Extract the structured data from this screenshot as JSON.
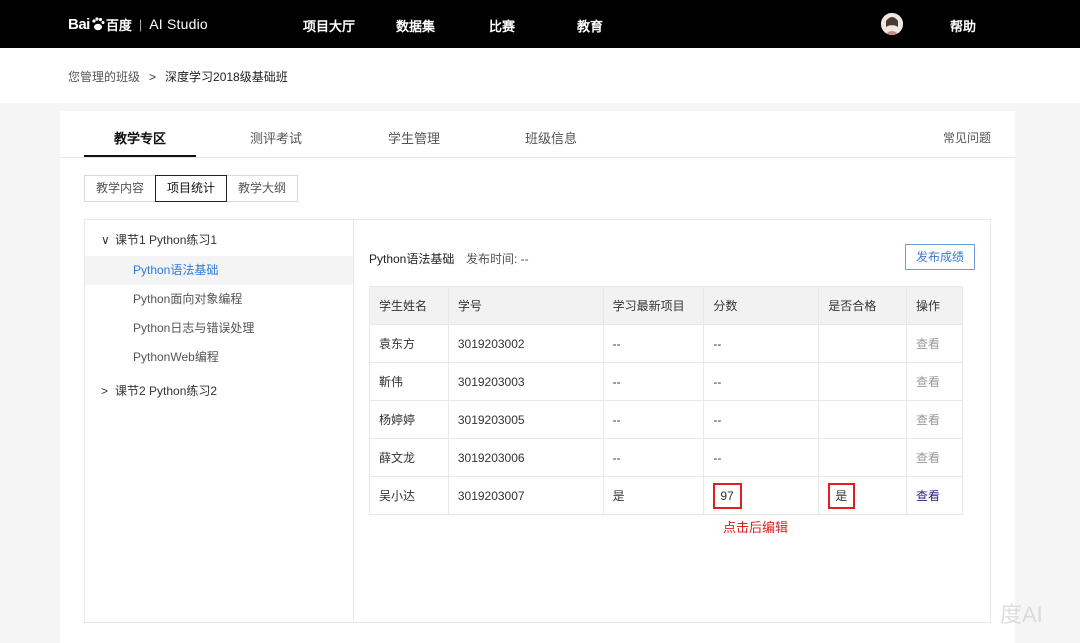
{
  "topbar": {
    "logo_bai": "Bai",
    "logo_du": "百度",
    "logo_sep": "|",
    "logo_studio": "AI Studio",
    "nav": [
      "项目大厅",
      "数据集",
      "比赛",
      "教育"
    ],
    "help": "帮助"
  },
  "breadcrumb": {
    "parent": "您管理的班级",
    "arrow": ">",
    "current": "深度学习2018级基础班"
  },
  "tabs": {
    "items": [
      "教学专区",
      "测评考试",
      "学生管理",
      "班级信息"
    ],
    "faq": "常见问题"
  },
  "subtabs": [
    "教学内容",
    "项目统计",
    "教学大纲"
  ],
  "tree": {
    "section1": "课节1 Python练习1",
    "section1_items": [
      "Python语法基础",
      "Python面向对象编程",
      "Python日志与错误处理",
      "PythonWeb编程"
    ],
    "section2": "课节2 Python练习2"
  },
  "content": {
    "lesson_title": "Python语法基础",
    "publish_time": "发布时间: --",
    "publish_button": "发布成绩",
    "columns": [
      "学生姓名",
      "学号",
      "学习最新项目",
      "分数",
      "是否合格",
      "操作"
    ],
    "rows": [
      [
        "袁东方",
        "3019203002",
        "--",
        "--",
        "",
        "查看"
      ],
      [
        "靳伟",
        "3019203003",
        "--",
        "--",
        "",
        "查看"
      ],
      [
        "杨婷婷",
        "3019203005",
        "--",
        "--",
        "",
        "查看"
      ],
      [
        "薛文龙",
        "3019203006",
        "--",
        "--",
        "",
        "查看"
      ],
      [
        "吴小达",
        "3019203007",
        "是",
        "97",
        "是",
        "查看"
      ]
    ],
    "edit_note": "点击后编辑"
  },
  "watermark": "度AI",
  "colors": {
    "accent": "#2e7ad9",
    "annotation": "#e02020"
  }
}
